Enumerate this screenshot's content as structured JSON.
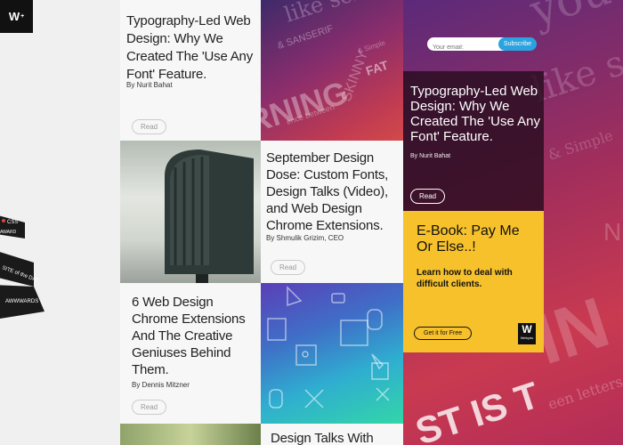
{
  "logo": {
    "text": "W",
    "sup": "+"
  },
  "award": {
    "css_label": "CSS",
    "award_label": "AWARD",
    "sotd_label": "SITE of the DAY",
    "awwwards": "AWWWARDS"
  },
  "cards": [
    {
      "title": "Typography-Led Web Design: Why We Created The 'Use Any Font' Feature.",
      "byline": "By Nurit Bahat",
      "read": "Read"
    },
    {
      "title": "September Design Dose: Custom Fonts, Design Talks (Video), and Web Design Chrome Extensions.",
      "byline": "By Shmulik Grizim, CEO",
      "read": "Read"
    },
    {
      "title": "6 Web Design Chrome Extensions And The Creative Geniuses Behind Them.",
      "byline": "By Dennis Mitzner",
      "read": "Read"
    },
    {
      "title": "Design Talks With"
    }
  ],
  "typo_bg": {
    "line1": "like serif",
    "line2": "& SANSERIF",
    "line3": "RNING",
    "line4": "FAT",
    "line5": "SKINNY",
    "line6": "ence between",
    "line7": "& Simple"
  },
  "right": {
    "email_placeholder": "Your email:",
    "subscribe": "Subscribe",
    "feature_title": "Typography-Led Web Design: Why We Created The 'Use Any Font' Feature.",
    "feature_byline": "By Nurit Bahat",
    "feature_read": "Read",
    "bg_words": {
      "a": "you",
      "b": "like serif",
      "c": "& Simple",
      "d": "N",
      "e": "IN",
      "f": "een letters &",
      "g": "ST IS T"
    }
  },
  "ebook": {
    "title": "E-Book: Pay Me Or Else..!",
    "desc": "Learn how to deal with difficult clients.",
    "cta": "Get it for Free",
    "logo_letter": "W",
    "logo_sub": "Webydo"
  },
  "colors": {
    "accent_blue": "#2ba3e0",
    "yellow": "#f7c12b",
    "magenta": "#a22e5c"
  }
}
